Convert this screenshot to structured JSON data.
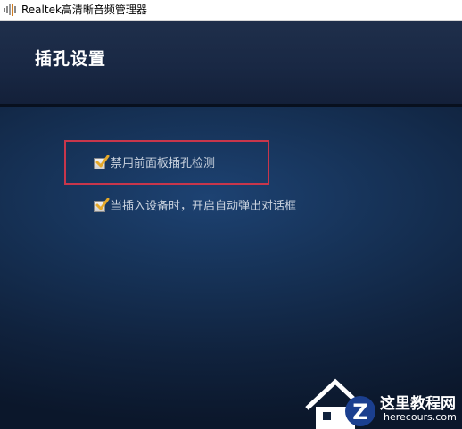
{
  "window": {
    "title": "Realtek高清晰音频管理器",
    "icon": "speaker-bars-icon"
  },
  "header": {
    "title": "插孔设置"
  },
  "options": [
    {
      "label": "禁用前面板插孔检测",
      "checked": true,
      "highlighted": true
    },
    {
      "label": "当插入设备时，开启自动弹出对话框",
      "checked": true,
      "highlighted": false
    }
  ],
  "watermark": {
    "site_name": "这里教程网",
    "url": "herecours.com"
  },
  "colors": {
    "highlight_border": "#c8364b",
    "check_mark": "#e5a92a",
    "label_text": "#c9d2de"
  }
}
